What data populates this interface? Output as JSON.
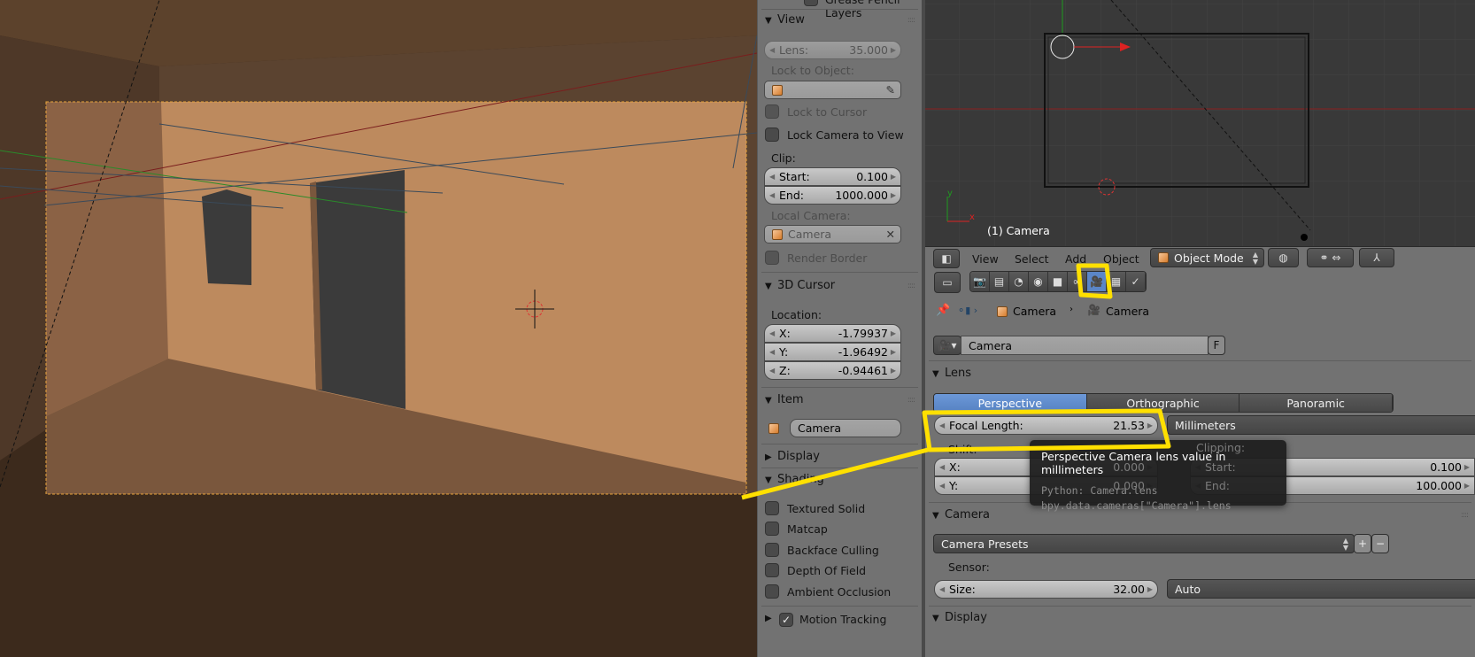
{
  "viewport3d": {
    "colors": {
      "wall": "#bd8a5e",
      "floor": "#7a573d",
      "ceiling": "#5c422c",
      "opening": "#3b3b3b",
      "frame": "#e8a33a"
    }
  },
  "npanel": {
    "partial_top": "Grease Pencil Layers",
    "view": {
      "title": "View",
      "lens_label": "Lens:",
      "lens_value": "35.000",
      "lock_to_object_label": "Lock to Object:",
      "lock_to_cursor": "Lock to Cursor",
      "lock_camera_to_view": "Lock Camera to View",
      "clip_label": "Clip:",
      "clip_start_label": "Start:",
      "clip_start_value": "0.100",
      "clip_end_label": "End:",
      "clip_end_value": "1000.000",
      "local_camera_label": "Local Camera:",
      "local_camera_value": "Camera",
      "render_border": "Render Border"
    },
    "cursor": {
      "title": "3D Cursor",
      "location_label": "Location:",
      "x_label": "X:",
      "x_value": "-1.79937",
      "y_label": "Y:",
      "y_value": "-1.96492",
      "z_label": "Z:",
      "z_value": "-0.94461"
    },
    "item": {
      "title": "Item",
      "name": "Camera"
    },
    "display": {
      "title": "Display"
    },
    "shading": {
      "title": "Shading",
      "options": [
        {
          "label": "Textured Solid",
          "checked": false
        },
        {
          "label": "Matcap",
          "checked": false
        },
        {
          "label": "Backface Culling",
          "checked": false
        },
        {
          "label": "Depth Of Field",
          "checked": false
        },
        {
          "label": "Ambient Occlusion",
          "checked": false
        }
      ]
    },
    "motion_tracking": {
      "title": "Motion Tracking",
      "checked": true
    }
  },
  "topview": {
    "object_label": "(1) Camera",
    "axis_x": "x",
    "axis_y": "y"
  },
  "header3d": {
    "menus": [
      "View",
      "Select",
      "Add",
      "Object"
    ],
    "mode": "Object Mode"
  },
  "properties": {
    "tabs": [
      "render",
      "render-layers",
      "scene",
      "world",
      "object",
      "constraints",
      "camera-data",
      "texture",
      "particles"
    ],
    "active_tab": "camera-data",
    "breadcrumb": [
      "Camera",
      "Camera"
    ],
    "datablock_name": "Camera",
    "datablock_fake_user": "F",
    "lens": {
      "title": "Lens",
      "types": [
        "Perspective",
        "Orthographic",
        "Panoramic"
      ],
      "active_type": "Perspective",
      "focal_label": "Focal Length:",
      "focal_value": "21.53",
      "unit": "Millimeters",
      "shift_label": "Shift:",
      "shift_x_label": "X:",
      "shift_x_value": "0.000",
      "shift_y_label": "Y:",
      "shift_y_value": "0.000",
      "clipping_label": "Clipping:",
      "clip_start_label": "Start:",
      "clip_start_value": "0.100",
      "clip_end_label": "End:",
      "clip_end_value": "100.000"
    },
    "camera": {
      "title": "Camera",
      "presets": "Camera Presets",
      "sensor_label": "Sensor:",
      "size_label": "Size:",
      "size_value": "32.00",
      "fit": "Auto"
    },
    "display": {
      "title": "Display"
    }
  },
  "tooltip": {
    "title": "Perspective Camera lens value in millimeters",
    "python": "Python: Camera.lens",
    "path": "bpy.data.cameras[\"Camera\"].lens"
  },
  "annotation_color": "#ffe000"
}
